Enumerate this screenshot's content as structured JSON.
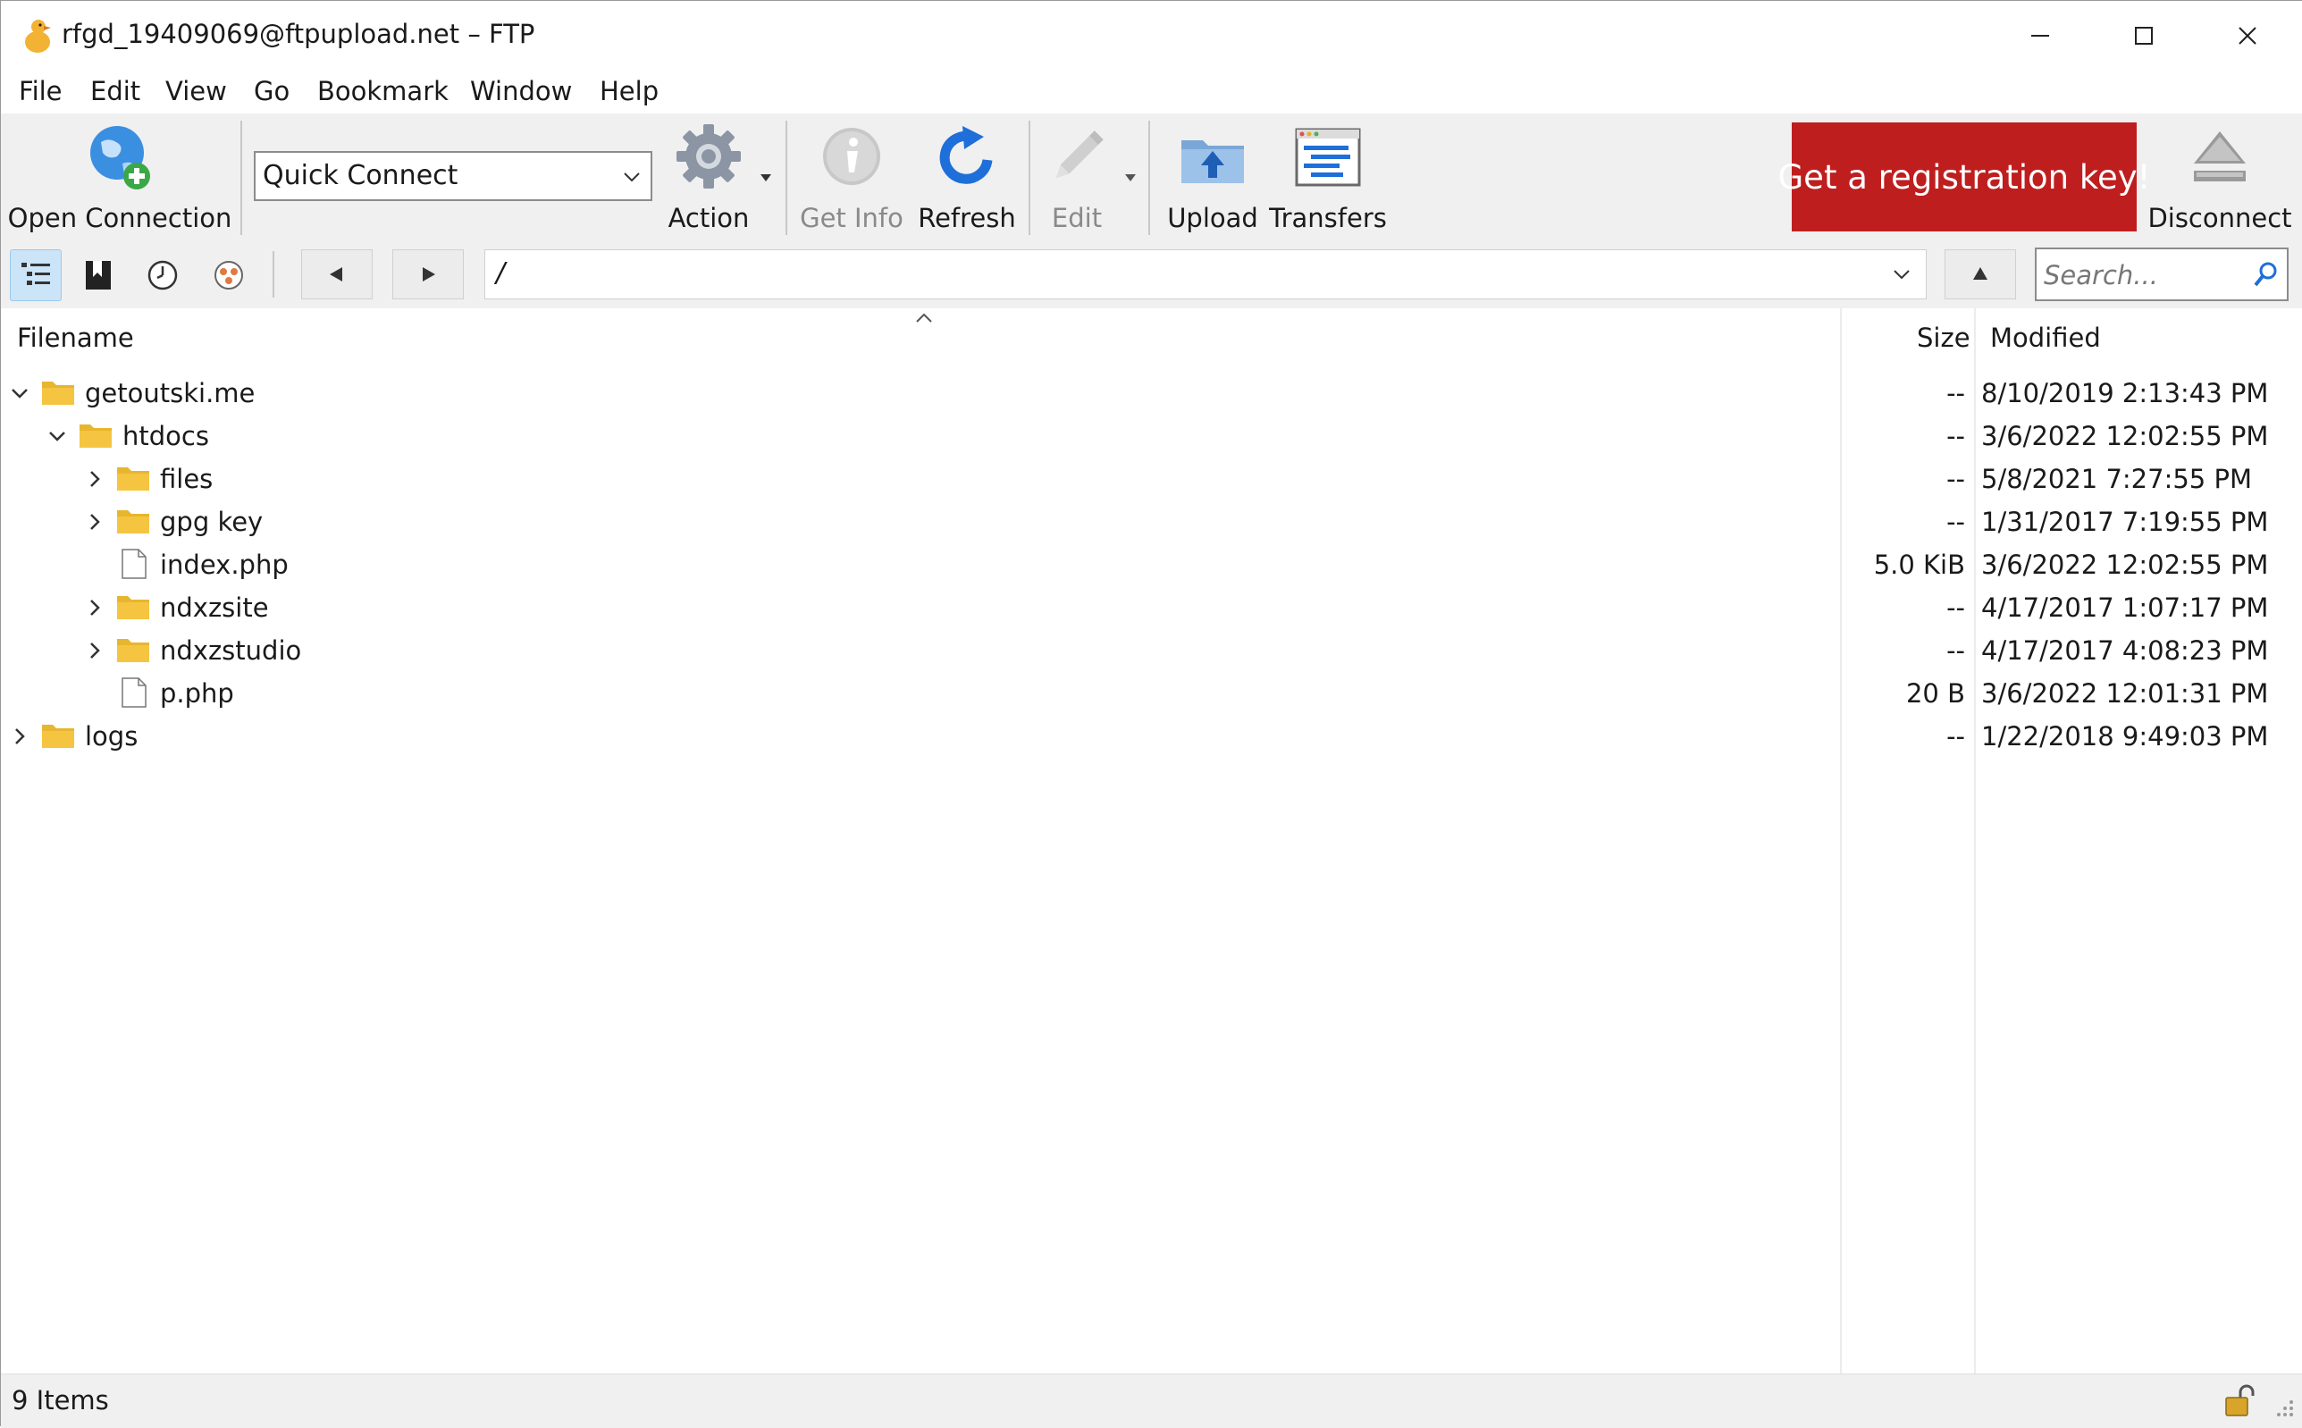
{
  "window": {
    "title": "rfgd_19409069@ftpupload.net – FTP"
  },
  "menu": [
    "File",
    "Edit",
    "View",
    "Go",
    "Bookmark",
    "Window",
    "Help"
  ],
  "toolbar": {
    "open_connection": "Open Connection",
    "quick_connect": "Quick Connect",
    "action": "Action",
    "get_info": "Get Info",
    "refresh": "Refresh",
    "edit": "Edit",
    "upload": "Upload",
    "transfers": "Transfers",
    "registration": "Get a registration key!",
    "disconnect": "Disconnect"
  },
  "nav": {
    "path": "/",
    "search_placeholder": "Search..."
  },
  "columns": {
    "filename": "Filename",
    "size": "Size",
    "modified": "Modified"
  },
  "files": [
    {
      "name": "getoutski.me",
      "kind": "folder",
      "depth": 0,
      "expander": "expanded",
      "size": "--",
      "modified": "8/10/2019 2:13:43 PM"
    },
    {
      "name": "htdocs",
      "kind": "folder",
      "depth": 1,
      "expander": "expanded",
      "size": "--",
      "modified": "3/6/2022 12:02:55 PM"
    },
    {
      "name": "files",
      "kind": "folder",
      "depth": 2,
      "expander": "collapsed",
      "size": "--",
      "modified": "5/8/2021 7:27:55 PM"
    },
    {
      "name": "gpg key",
      "kind": "folder",
      "depth": 2,
      "expander": "collapsed",
      "size": "--",
      "modified": "1/31/2017 7:19:55 PM"
    },
    {
      "name": "index.php",
      "kind": "file",
      "depth": 2,
      "expander": "none",
      "size": "5.0 KiB",
      "modified": "3/6/2022 12:02:55 PM"
    },
    {
      "name": "ndxzsite",
      "kind": "folder",
      "depth": 2,
      "expander": "collapsed",
      "size": "--",
      "modified": "4/17/2017 1:07:17 PM"
    },
    {
      "name": "ndxzstudio",
      "kind": "folder",
      "depth": 2,
      "expander": "collapsed",
      "size": "--",
      "modified": "4/17/2017 4:08:23 PM"
    },
    {
      "name": "p.php",
      "kind": "file",
      "depth": 2,
      "expander": "none",
      "size": "20 B",
      "modified": "3/6/2022 12:01:31 PM"
    },
    {
      "name": "logs",
      "kind": "folder",
      "depth": 0,
      "expander": "collapsed",
      "size": "--",
      "modified": "1/22/2018 9:49:03 PM"
    }
  ],
  "status": {
    "items": "9 Items"
  },
  "colors": {
    "registration_bg": "#bf1e1e",
    "folder": "#f5c542",
    "toolbar_bg": "#f0f0f0",
    "accent_blue": "#1e6fd9"
  }
}
